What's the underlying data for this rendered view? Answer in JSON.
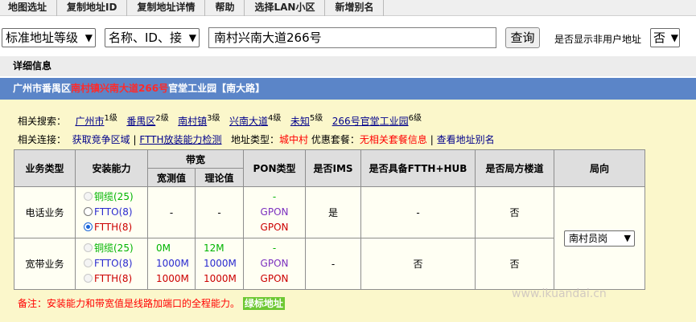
{
  "menu": [
    {
      "label": "地图选址"
    },
    {
      "label": "复制地址ID"
    },
    {
      "label": "复制地址详情"
    },
    {
      "label": "帮助"
    },
    {
      "label": "选择LAN小区"
    },
    {
      "label": "新增别名"
    }
  ],
  "search": {
    "level_select": "标准地址等级",
    "field_select": "名称、ID、接",
    "address_value": "南村兴南大道266号",
    "query_button": "查询",
    "show_nonuser_label": "是否显示非用户地址",
    "show_nonuser_value": "否"
  },
  "detail": {
    "title": "详细信息",
    "address_prefix": "广州市番禺区",
    "address_highlight": "南村镇兴南大道266号",
    "address_suffix": "官堂工业园【南大路】"
  },
  "related_search": {
    "label": "相关搜索：",
    "items": [
      {
        "text": "广州市",
        "level": "1级"
      },
      {
        "text": "番禺区",
        "level": "2级"
      },
      {
        "text": "南村镇",
        "level": "3级"
      },
      {
        "text": "兴南大道",
        "level": "4级"
      },
      {
        "text": "未知",
        "level": "5级"
      },
      {
        "text": "266号官堂工业园",
        "level": "6级"
      }
    ]
  },
  "related_links": {
    "label": "相关连接：",
    "competition": "获取竞争区域",
    "sep1": "|",
    "ftth_check": "FTTH放装能力检测",
    "addr_type_label": "地址类型：",
    "addr_type_value": "城中村",
    "promo_label": "优惠套餐：",
    "promo_value": "无相关套餐信息",
    "sep2": "|",
    "alias_link": "查看地址别名"
  },
  "table": {
    "headers": {
      "biz_type": "业务类型",
      "install": "安装能力",
      "bandwidth": "带宽",
      "measured": "宽测值",
      "theory": "理论值",
      "pon": "PON类型",
      "ims": "是否IMS",
      "ftth_hub": "是否具备FTTH+HUB",
      "bureau_building": "是否局方楼道",
      "bureau": "局向"
    },
    "rows": [
      {
        "biz": "电话业务",
        "options": [
          "铜缆(25)",
          "FTTO(8)",
          "FTTH(8)"
        ],
        "measured": "-",
        "theory": "-",
        "pon": [
          "-",
          "GPON",
          "GPON"
        ],
        "ims": "是",
        "ftth_hub": "-",
        "bureau_building": "否"
      },
      {
        "biz": "宽带业务",
        "options": [
          "铜缆(25)",
          "FTTO(8)",
          "FTTH(8)"
        ],
        "measured": [
          "0M",
          "1000M",
          "1000M"
        ],
        "theory": [
          "12M",
          "1000M",
          "1000M"
        ],
        "pon": [
          "-",
          "GPON",
          "GPON"
        ],
        "ims": "-",
        "ftth_hub": "否",
        "bureau_building": "否"
      }
    ],
    "bureau_select": "南村员岗"
  },
  "note": {
    "text": "备注：安装能力和带宽值是线路加端口的全程能力。",
    "badge": "绿标地址"
  },
  "watermark": "www.ikuandai.cn"
}
